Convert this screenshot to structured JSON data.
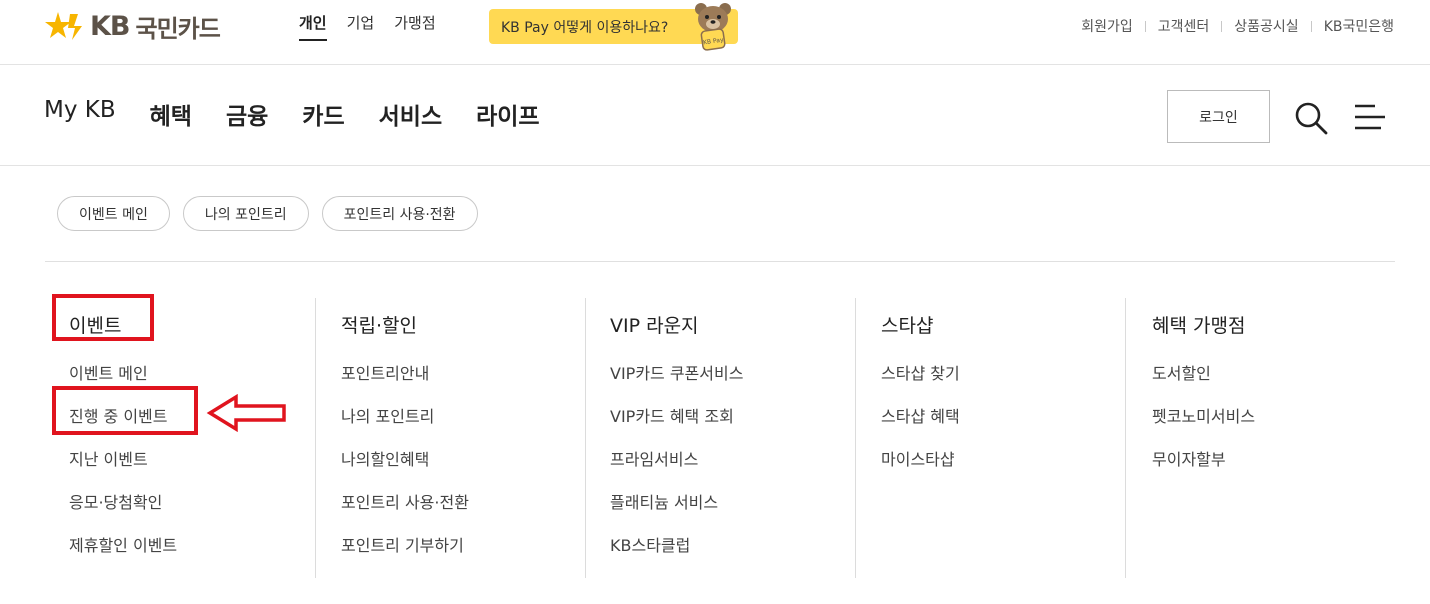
{
  "brand": {
    "logo_kb": "KB",
    "logo_name": "국민카드"
  },
  "segments": [
    {
      "label": "개인",
      "active": true
    },
    {
      "label": "기업",
      "active": false
    },
    {
      "label": "가맹점",
      "active": false
    }
  ],
  "pay_banner": {
    "text": "KB Pay 어떻게 이용하나요?",
    "bear_badge": "KB Pay"
  },
  "util_links": [
    "회원가입",
    "고객센터",
    "상품공시실",
    "KB국민은행"
  ],
  "gnb": [
    {
      "label": "My KB",
      "active": false
    },
    {
      "label": "혜택",
      "active": true
    },
    {
      "label": "금융",
      "active": false
    },
    {
      "label": "카드",
      "active": false
    },
    {
      "label": "서비스",
      "active": false
    },
    {
      "label": "라이프",
      "active": false
    }
  ],
  "login_label": "로그인",
  "chips": [
    "이벤트 메인",
    "나의 포인트리",
    "포인트리 사용·전환"
  ],
  "columns": [
    {
      "title": "이벤트",
      "items": [
        "이벤트 메인",
        "진행 중 이벤트",
        "지난 이벤트",
        "응모·당첨확인",
        "제휴할인 이벤트"
      ]
    },
    {
      "title": "적립·할인",
      "items": [
        "포인트리안내",
        "나의 포인트리",
        "나의할인혜택",
        "포인트리 사용·전환",
        "포인트리 기부하기"
      ]
    },
    {
      "title": "VIP 라운지",
      "items": [
        "VIP카드 쿠폰서비스",
        "VIP카드 혜택 조회",
        "프라임서비스",
        "플래티늄 서비스",
        "KB스타클럽"
      ]
    },
    {
      "title": "스타샵",
      "items": [
        "스타샵 찾기",
        "스타샵 혜택",
        "마이스타샵"
      ]
    },
    {
      "title": "혜택 가맹점",
      "items": [
        "도서할인",
        "펫코노미서비스",
        "무이자할부"
      ]
    }
  ],
  "colors": {
    "accent": "#ffd953",
    "brand_text": "#5c5248",
    "annotation_red": "#e0141e"
  }
}
